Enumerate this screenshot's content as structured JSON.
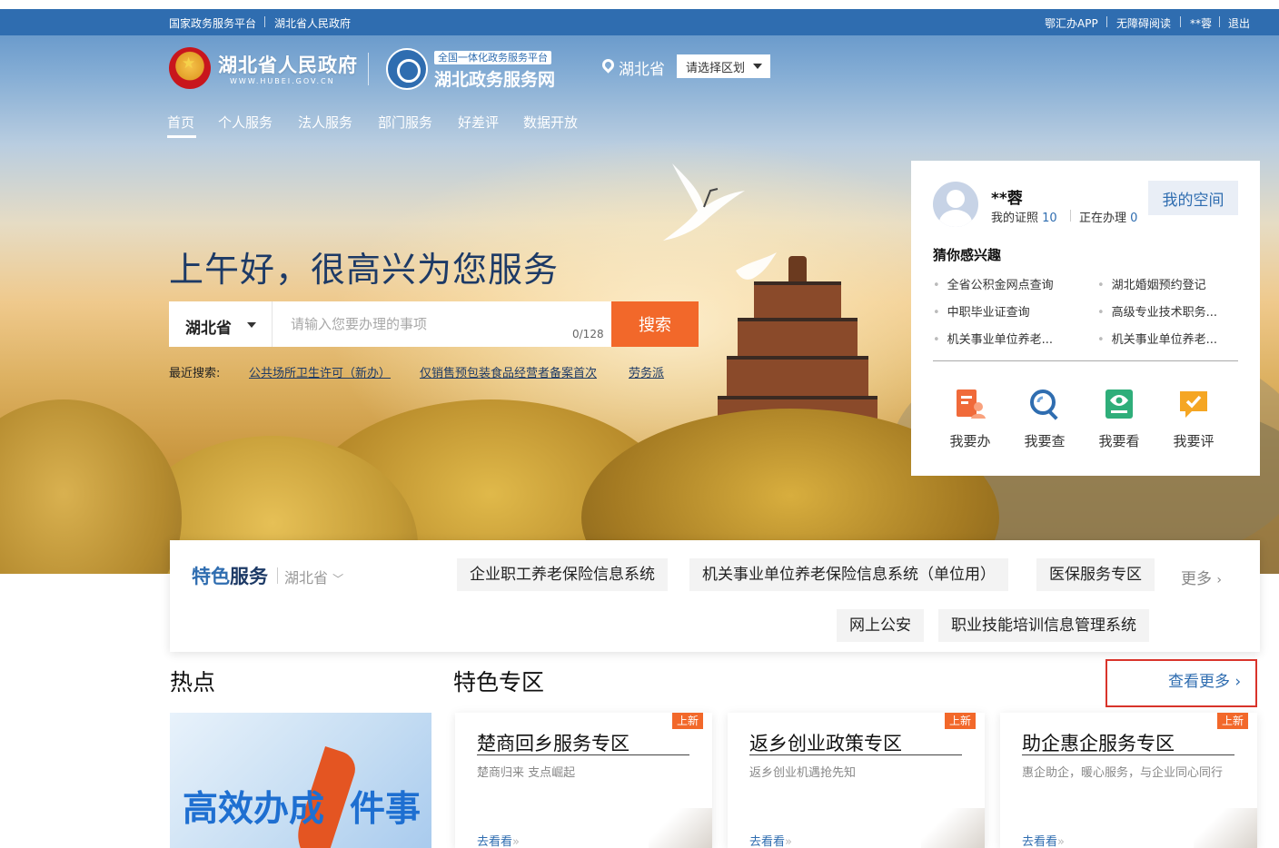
{
  "topbar": {
    "left_links": [
      "国家政务服务平台",
      "湖北省人民政府"
    ],
    "right_links": [
      "鄂汇办APP",
      "无障碍阅读",
      "**蓉",
      "退出"
    ]
  },
  "header": {
    "gov_name": "湖北省人民政府",
    "gov_url": "WWW.HUBEI.GOV.CN",
    "service_tag": "全国一体化政务服务平台",
    "service_name": "湖北政务服务网",
    "location": "湖北省",
    "region_select": "请选择区划"
  },
  "nav": {
    "items": [
      "首页",
      "个人服务",
      "法人服务",
      "部门服务",
      "好差评",
      "数据开放"
    ],
    "active": "首页"
  },
  "hero": {
    "greeting": "上午好，很高兴为您服务",
    "search": {
      "province": "湖北省",
      "placeholder": "请输入您要办理的事项",
      "count": "0/128",
      "button": "搜索"
    },
    "recent_label": "最近搜索:",
    "recent": [
      "公共场所卫生许可（新办）",
      "仅销售预包装食品经营者备案首次",
      "劳务派"
    ]
  },
  "user": {
    "name": "**蓉",
    "cert_label": "我的证照",
    "cert_count": "10",
    "handling_label": "正在办理",
    "handling_count": "0",
    "space_button": "我的空间",
    "interest_title": "猜你感兴趣",
    "interests": [
      "全省公积金网点查询",
      "湖北婚姻预约登记",
      "中职毕业证查询",
      "高级专业技术职务...",
      "机关事业单位养老...",
      "机关事业单位养老..."
    ],
    "actions": [
      "我要办",
      "我要查",
      "我要看",
      "我要评"
    ]
  },
  "featured": {
    "title_a": "特色",
    "title_b": "服务",
    "province": "湖北省",
    "chips": [
      "企业职工养老保险信息系统",
      "机关事业单位养老保险信息系统（单位用）",
      "医保服务专区",
      "网上公安",
      "职业技能培训信息管理系统"
    ],
    "more": "更多"
  },
  "hot": {
    "title": "热点",
    "banner_a": "高效办成",
    "banner_b": "件事"
  },
  "zones": {
    "title": "特色专区",
    "more": "查看更多",
    "cards": [
      {
        "badge": "上新",
        "title": "楚商回乡服务专区",
        "desc": "楚商归来 支点崛起",
        "go": "去看看"
      },
      {
        "badge": "上新",
        "title": "返乡创业政策专区",
        "desc": "返乡创业机遇抢先知",
        "go": "去看看"
      },
      {
        "badge": "上新",
        "title": "助企惠企服务专区",
        "desc": "惠企助企，暖心服务，与企业同心同行",
        "go": "去看看"
      }
    ]
  },
  "colors": {
    "brand_blue": "#2f6db0",
    "search_orange": "#f2682a",
    "highlight_red": "#d9342b"
  }
}
